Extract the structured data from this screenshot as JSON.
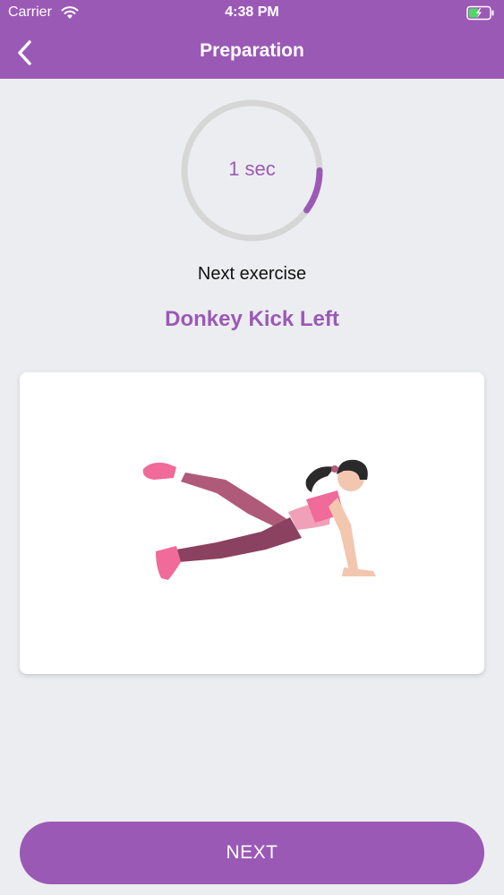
{
  "status_bar": {
    "carrier": "Carrier",
    "time": "4:38 PM",
    "wifi_icon": "wifi-icon",
    "battery_icon": "battery-charging-icon"
  },
  "nav": {
    "title": "Preparation",
    "back_icon": "chevron-left-icon"
  },
  "timer": {
    "text": "1 sec",
    "progress": 0.1,
    "track_color": "#d6d6d6",
    "progress_color": "#9b59b6"
  },
  "next_exercise": {
    "label": "Next exercise",
    "name": "Donkey Kick Left"
  },
  "illustration": {
    "icon": "donkey-kick-illustration"
  },
  "footer": {
    "next_label": "NEXT"
  },
  "colors": {
    "accent": "#9b59b6",
    "background": "#ecedf0"
  }
}
